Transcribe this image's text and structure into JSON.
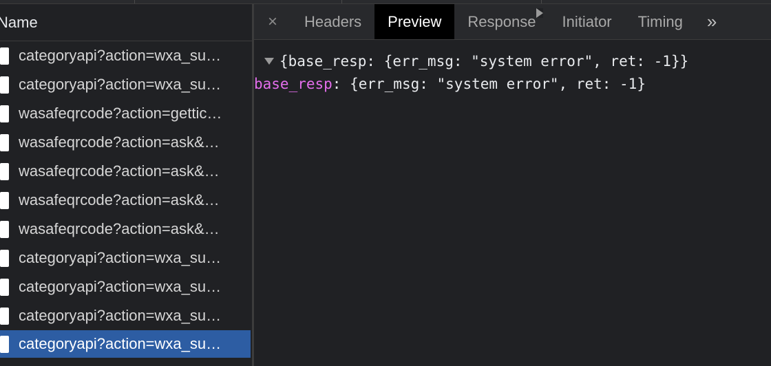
{
  "requests": {
    "column_header": "Name",
    "items": [
      {
        "label": "categoryapi?action=wxa_su…",
        "selected": false
      },
      {
        "label": "categoryapi?action=wxa_su…",
        "selected": false
      },
      {
        "label": "wasafeqrcode?action=gettic…",
        "selected": false
      },
      {
        "label": "wasafeqrcode?action=ask&…",
        "selected": false
      },
      {
        "label": "wasafeqrcode?action=ask&…",
        "selected": false
      },
      {
        "label": "wasafeqrcode?action=ask&…",
        "selected": false
      },
      {
        "label": "wasafeqrcode?action=ask&…",
        "selected": false
      },
      {
        "label": "categoryapi?action=wxa_su…",
        "selected": false
      },
      {
        "label": "categoryapi?action=wxa_su…",
        "selected": false
      },
      {
        "label": "categoryapi?action=wxa_su…",
        "selected": false
      },
      {
        "label": "categoryapi?action=wxa_su…",
        "selected": true
      }
    ]
  },
  "tabs": {
    "close_glyph": "×",
    "items": [
      {
        "label": "Headers",
        "active": false
      },
      {
        "label": "Preview",
        "active": true
      },
      {
        "label": "Response",
        "active": false
      },
      {
        "label": "Initiator",
        "active": false
      },
      {
        "label": "Timing",
        "active": false
      }
    ],
    "more_glyph": "»"
  },
  "preview": {
    "summary": "{base_resp: {err_msg: \"system error\", ret: -1}}",
    "child_key": "base_resp",
    "child_sep": ": ",
    "child_value": "{err_msg: \"system error\", ret: -1}"
  },
  "colors": {
    "selected_row": "#2d5da3",
    "key_color": "#e36eec",
    "background": "#202124"
  }
}
